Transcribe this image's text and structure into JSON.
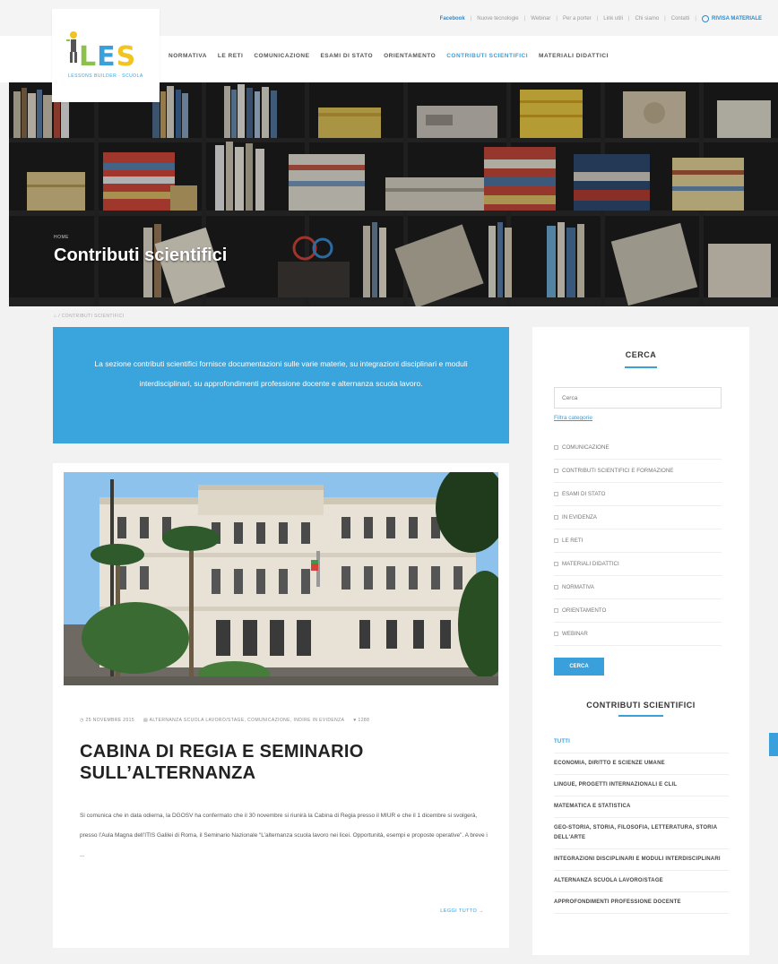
{
  "toplinks": {
    "facebook": "Facebook",
    "items": [
      "Nuove tecnologie",
      "Webinar",
      "Per a porter",
      "Link utili",
      "Chi siamo",
      "Contatti"
    ],
    "material": "RIVISA MATERIALE"
  },
  "logo": {
    "l": "L",
    "e": "E",
    "s": "S",
    "sub": "LESSONS BUILDER · SCUOLA"
  },
  "nav": [
    "NORMATIVA",
    "LE RETI",
    "COMUNICAZIONE",
    "ESAMI DI STATO",
    "ORIENTAMENTO",
    "CONTRIBUTI SCIENTIFICI",
    "MATERIALI DIDATTICI"
  ],
  "hero": {
    "tag": "HOME",
    "title": "Contributi scientifici"
  },
  "breadcrumb": "⌂ / CONTRIBUTI SCIENTIFICI",
  "intro": "La sezione contributi scientifici fornisce documentazioni sulle varie materie, su integrazioni disciplinari e moduli interdisciplinari, su approfondimenti professione docente e alternanza scuola lavoro.",
  "post": {
    "meta": [
      "◷ 25 NOVEMBRE 2015",
      "▤ ALTERNANZA SCUOLA LAVORO/STAGE, COMUNICAZIONE, INDIRE IN EVIDENZA",
      "♥ 1288"
    ],
    "title": "CABINA DI REGIA E SEMINARIO SULL’ALTERNANZA",
    "text": "Si comunica che in data odierna, la DGOSV ha confermato che il 30 novembre si riunirà la Cabina di Regia presso il MIUR e che il 1 dicembre si svolgerà, presso l’Aula Magna dell’ITIS Galilei di Roma, il Seminario Nazionale “L’alternanza scuola lavoro nei licei. Opportunità, esempi e proposte operative”. A breve i ...",
    "more": "LEGGI TUTTO →"
  },
  "sidebar": {
    "search_title": "CERCA",
    "search_placeholder": "Cerca",
    "filter_link": "Filtra categorie",
    "categories": [
      "COMUNICAZIONE",
      "CONTRIBUTI SCIENTIFICI E FORMAZIONE",
      "ESAMI DI STATO",
      "IN EVIDENZA",
      "LE RETI",
      "MATERIALI DIDATTICI",
      "NORMATIVA",
      "ORIENTAMENTO",
      "WEBINAR"
    ],
    "search_button": "CERCA",
    "topics_title": "CONTRIBUTI SCIENTIFICI",
    "topics": [
      "TUTTI",
      "ECONOMIA, DIRITTO E SCIENZE UMANE",
      "LINGUE, PROGETTI INTERNAZIONALI E CLIL",
      "MATEMATICA E STATISTICA",
      "GEO-STORIA, STORIA, FILOSOFIA, LETTERATURA, STORIA DELL'ARTE",
      "INTEGRAZIONI DISCIPLINARI E MODULI INTERDISCIPLINARI",
      "ALTERNANZA SCUOLA LAVORO/STAGE",
      "APPROFONDIMENTI PROFESSIONE DOCENTE"
    ]
  },
  "colors": {
    "accent": "#3aa0dc",
    "logo_green": "#8bc34a",
    "logo_yellow": "#f2c41f"
  }
}
